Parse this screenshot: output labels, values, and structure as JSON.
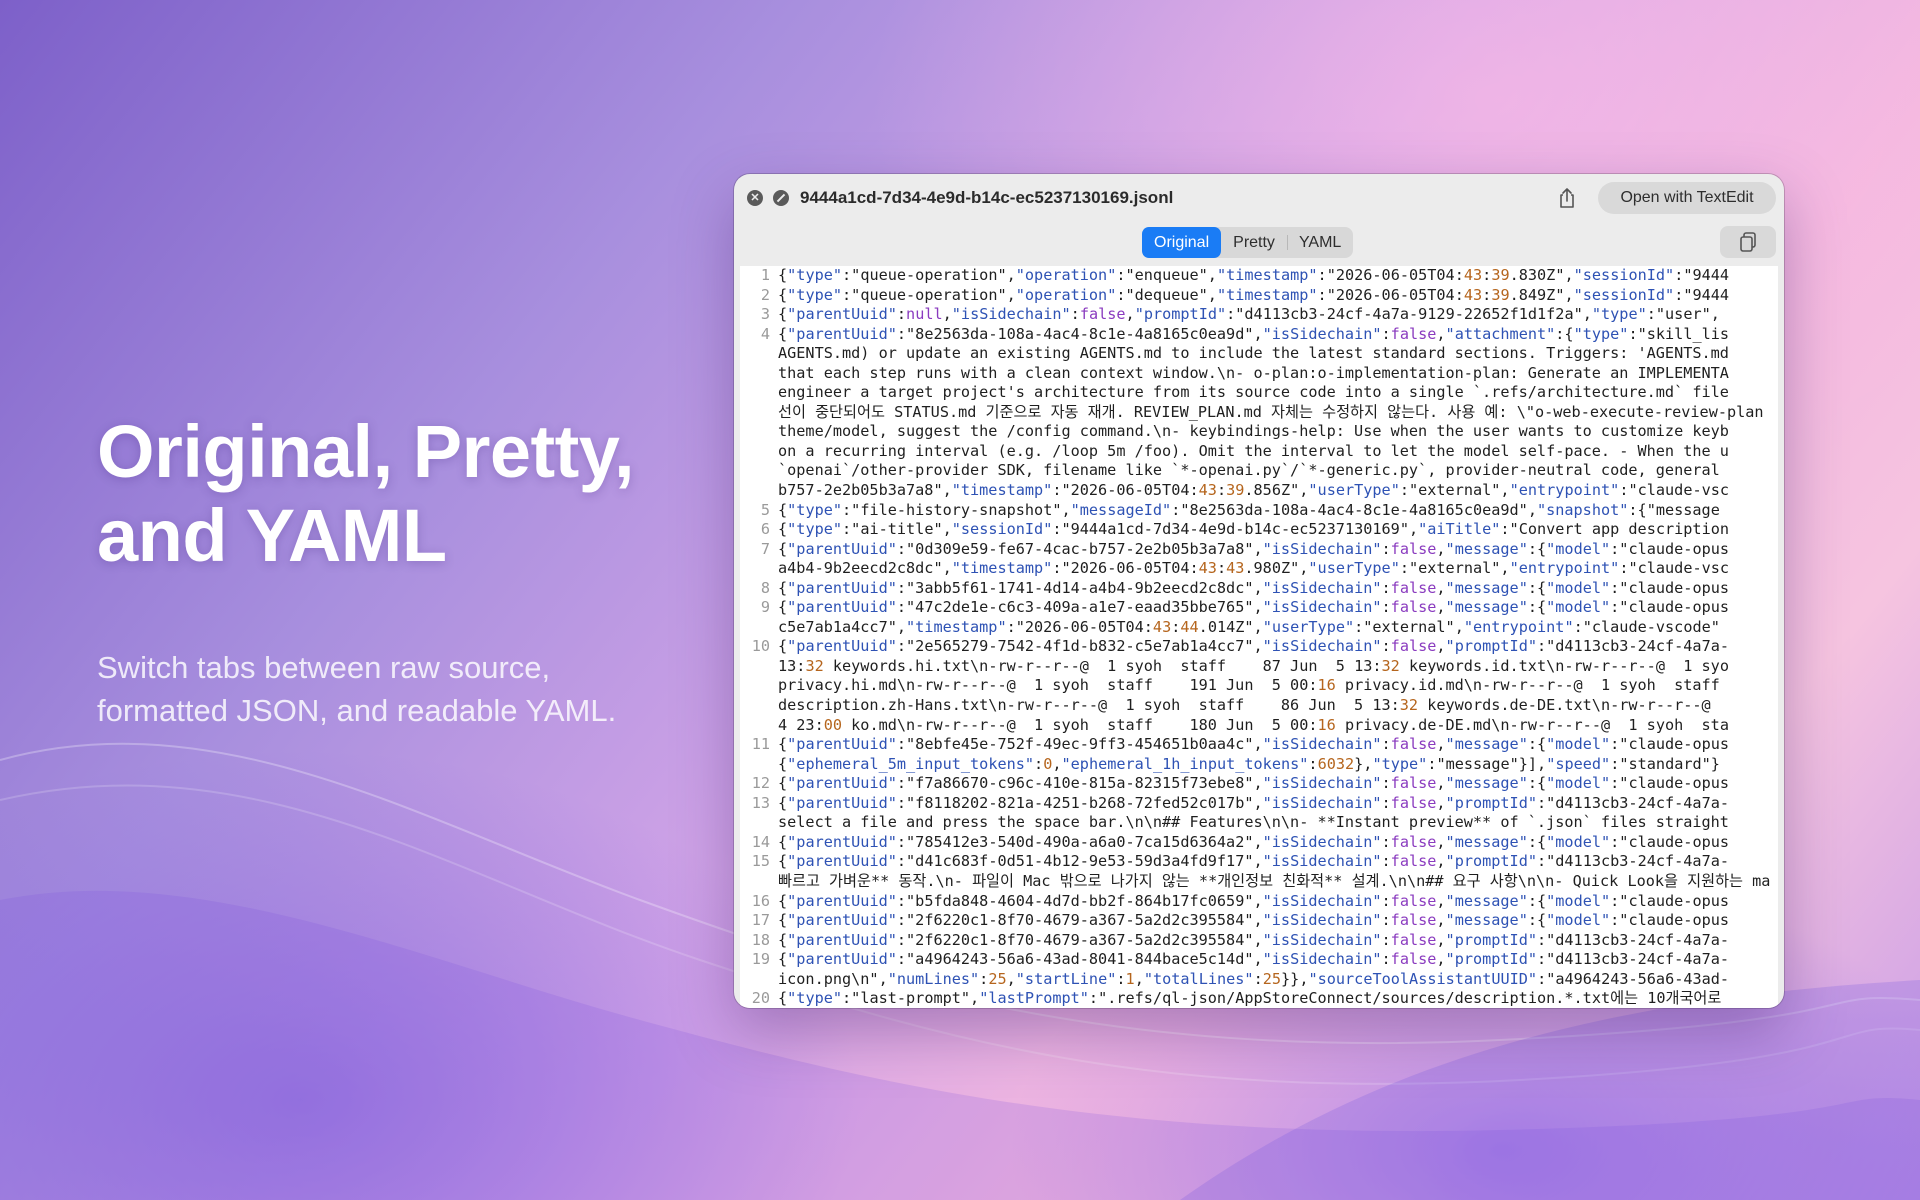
{
  "hero": {
    "title_line1": "Original, Pretty,",
    "title_line2": "and YAML",
    "subtitle_line1": "Switch tabs between raw source,",
    "subtitle_line2": "formatted JSON, and readable YAML."
  },
  "window": {
    "file_name": "9444a1cd-7d34-4e9d-b14c-ec5237130169.jsonl",
    "open_button_label": "Open with TextEdit",
    "tabs": [
      {
        "label": "Original",
        "active": true
      },
      {
        "label": "Pretty",
        "active": false
      },
      {
        "label": "YAML",
        "active": false
      }
    ],
    "icons": [
      "close-icon",
      "block-icon",
      "share-icon",
      "copy-icon"
    ],
    "accent_color": "#1a7cf5"
  },
  "code": [
    {
      "num": "1",
      "text": "{\"type\":\"queue-operation\",\"operation\":\"enqueue\",\"timestamp\":\"2026-06-05T04:43:39.830Z\",\"sessionId\":\"9444"
    },
    {
      "num": "2",
      "text": "{\"type\":\"queue-operation\",\"operation\":\"dequeue\",\"timestamp\":\"2026-06-05T04:43:39.849Z\",\"sessionId\":\"9444"
    },
    {
      "num": "3",
      "text": "{\"parentUuid\":null,\"isSidechain\":false,\"promptId\":\"d4113cb3-24cf-4a7a-9129-22652f1d1f2a\",\"type\":\"user\","
    },
    {
      "num": "4",
      "text": "{\"parentUuid\":\"8e2563da-108a-4ac4-8c1e-4a8165c0ea9d\",\"isSidechain\":false,\"attachment\":{\"type\":\"skill_lis"
    },
    {
      "num": "",
      "text": "AGENTS.md) or update an existing AGENTS.md to include the latest standard sections. Triggers: 'AGENTS.md"
    },
    {
      "num": "",
      "text": "that each step runs with a clean context window.\\n- o-plan:o-implementation-plan: Generate an IMPLEMENTA"
    },
    {
      "num": "",
      "text": "engineer a target project's architecture from its source code into a single `.refs/architecture.md` file"
    },
    {
      "num": "",
      "text": "선이 중단되어도 STATUS.md 기준으로 자동 재개. REVIEW_PLAN.md 자체는 수정하지 않는다. 사용 예: \\\"o-web-execute-review-plan"
    },
    {
      "num": "",
      "text": "theme/model, suggest the /config command.\\n- keybindings-help: Use when the user wants to customize keyb"
    },
    {
      "num": "",
      "text": "on a recurring interval (e.g. /loop 5m /foo). Omit the interval to let the model self-pace. - When the u"
    },
    {
      "num": "",
      "text": "`openai`/other-provider SDK, filename like `*-openai.py`/`*-generic.py`, provider-neutral code, general"
    },
    {
      "num": "",
      "text": "b757-2e2b05b3a7a8\",\"timestamp\":\"2026-06-05T04:43:39.856Z\",\"userType\":\"external\",\"entrypoint\":\"claude-vsc"
    },
    {
      "num": "5",
      "text": "{\"type\":\"file-history-snapshot\",\"messageId\":\"8e2563da-108a-4ac4-8c1e-4a8165c0ea9d\",\"snapshot\":{\"message"
    },
    {
      "num": "6",
      "text": "{\"type\":\"ai-title\",\"sessionId\":\"9444a1cd-7d34-4e9d-b14c-ec5237130169\",\"aiTitle\":\"Convert app description"
    },
    {
      "num": "7",
      "text": "{\"parentUuid\":\"0d309e59-fe67-4cac-b757-2e2b05b3a7a8\",\"isSidechain\":false,\"message\":{\"model\":\"claude-opus"
    },
    {
      "num": "",
      "text": "a4b4-9b2eecd2c8dc\",\"timestamp\":\"2026-06-05T04:43:43.980Z\",\"userType\":\"external\",\"entrypoint\":\"claude-vsc"
    },
    {
      "num": "8",
      "text": "{\"parentUuid\":\"3abb5f61-1741-4d14-a4b4-9b2eecd2c8dc\",\"isSidechain\":false,\"message\":{\"model\":\"claude-opus"
    },
    {
      "num": "9",
      "text": "{\"parentUuid\":\"47c2de1e-c6c3-409a-a1e7-eaad35bbe765\",\"isSidechain\":false,\"message\":{\"model\":\"claude-opus"
    },
    {
      "num": "",
      "text": "c5e7ab1a4cc7\",\"timestamp\":\"2026-06-05T04:43:44.014Z\",\"userType\":\"external\",\"entrypoint\":\"claude-vscode\""
    },
    {
      "num": "10",
      "text": "{\"parentUuid\":\"2e565279-7542-4f1d-b832-c5e7ab1a4cc7\",\"isSidechain\":false,\"promptId\":\"d4113cb3-24cf-4a7a-"
    },
    {
      "num": "",
      "text": "13:32 keywords.hi.txt\\n-rw-r--r--@  1 syoh  staff    87 Jun  5 13:32 keywords.id.txt\\n-rw-r--r--@  1 syo"
    },
    {
      "num": "",
      "text": "privacy.hi.md\\n-rw-r--r--@  1 syoh  staff    191 Jun  5 00:16 privacy.id.md\\n-rw-r--r--@  1 syoh  staff"
    },
    {
      "num": "",
      "text": "description.zh-Hans.txt\\n-rw-r--r--@  1 syoh  staff    86 Jun  5 13:32 keywords.de-DE.txt\\n-rw-r--r--@"
    },
    {
      "num": "",
      "text": "4 23:00 ko.md\\n-rw-r--r--@  1 syoh  staff    180 Jun  5 00:16 privacy.de-DE.md\\n-rw-r--r--@  1 syoh  sta"
    },
    {
      "num": "11",
      "text": "{\"parentUuid\":\"8ebfe45e-752f-49ec-9ff3-454651b0aa4c\",\"isSidechain\":false,\"message\":{\"model\":\"claude-opus"
    },
    {
      "num": "",
      "text": "{\"ephemeral_5m_input_tokens\":0,\"ephemeral_1h_input_tokens\":6032},\"type\":\"message\"}],\"speed\":\"standard\"}"
    },
    {
      "num": "12",
      "text": "{\"parentUuid\":\"f7a86670-c96c-410e-815a-82315f73ebe8\",\"isSidechain\":false,\"message\":{\"model\":\"claude-opus"
    },
    {
      "num": "13",
      "text": "{\"parentUuid\":\"f8118202-821a-4251-b268-72fed52c017b\",\"isSidechain\":false,\"promptId\":\"d4113cb3-24cf-4a7a-"
    },
    {
      "num": "",
      "text": "select a file and press the space bar.\\n\\n## Features\\n\\n- **Instant preview** of `.json` files straight"
    },
    {
      "num": "14",
      "text": "{\"parentUuid\":\"785412e3-540d-490a-a6a0-7ca15d6364a2\",\"isSidechain\":false,\"message\":{\"model\":\"claude-opus"
    },
    {
      "num": "15",
      "text": "{\"parentUuid\":\"d41c683f-0d51-4b12-9e53-59d3a4fd9f17\",\"isSidechain\":false,\"promptId\":\"d4113cb3-24cf-4a7a-"
    },
    {
      "num": "",
      "text": "빠르고 가벼운** 동작.\\n- 파일이 Mac 밖으로 나가지 않는 **개인정보 친화적** 설계.\\n\\n## 요구 사항\\n\\n- Quick Look을 지원하는 ma"
    },
    {
      "num": "16",
      "text": "{\"parentUuid\":\"b5fda848-4604-4d7d-bb2f-864b17fc0659\",\"isSidechain\":false,\"message\":{\"model\":\"claude-opus"
    },
    {
      "num": "17",
      "text": "{\"parentUuid\":\"2f6220c1-8f70-4679-a367-5a2d2c395584\",\"isSidechain\":false,\"message\":{\"model\":\"claude-opus"
    },
    {
      "num": "18",
      "text": "{\"parentUuid\":\"2f6220c1-8f70-4679-a367-5a2d2c395584\",\"isSidechain\":false,\"promptId\":\"d4113cb3-24cf-4a7a-"
    },
    {
      "num": "19",
      "text": "{\"parentUuid\":\"a4964243-56a6-43ad-8041-844bace5c14d\",\"isSidechain\":false,\"promptId\":\"d4113cb3-24cf-4a7a-"
    },
    {
      "num": "",
      "text": "icon.png\\n\",\"numLines\":25,\"startLine\":1,\"totalLines\":25}},\"sourceToolAssistantUUID\":\"a4964243-56a6-43ad-"
    },
    {
      "num": "20",
      "text": "{\"type\":\"last-prompt\",\"lastPrompt\":\".refs/ql-json/AppStoreConnect/sources/description.*.txt에는 10개국어로"
    }
  ]
}
